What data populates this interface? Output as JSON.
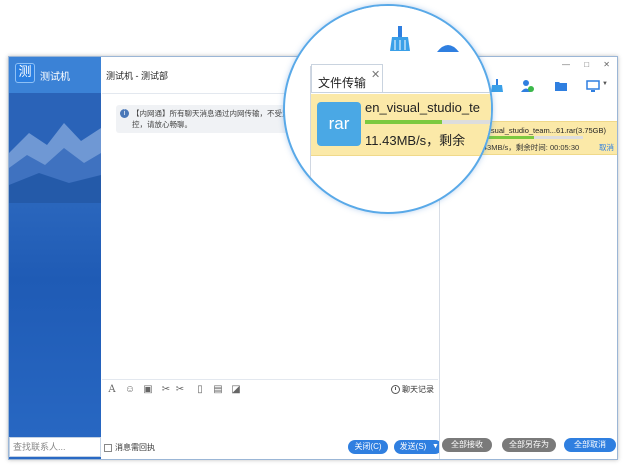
{
  "app": {
    "name": "测试机",
    "logo_char": "测"
  },
  "sidebar": {
    "search_placeholder": "查找联系人..."
  },
  "chat": {
    "title": "测试机 - 测试部",
    "notice": "【内网通】所有聊天消息通过内网传输，不受监控，请放心畅聊。",
    "history_label": "聊天记录",
    "read_receipt_label": "消息需回执",
    "close_label": "关闭(C)",
    "send_label": "发送(S)"
  },
  "window_controls": "— □ ✕",
  "transfer": {
    "panel_title": "文件传输",
    "file_type": "rar",
    "file_name_full": "en_visual_studio_team...61.rar(3.75GB)",
    "file_name_zoom": "en_visual_studio_te",
    "speed_full": "11.43MB/s，剩余时间: 00:05:30",
    "speed_zoom": "11.43MB/s，剩余",
    "cancel_label": "取消",
    "progress": 0.55
  },
  "actions": {
    "accept_all": "全部接收",
    "save_all_as": "全部另存为",
    "cancel_all": "全部取消"
  },
  "colors": {
    "accent": "#2f7fe0",
    "gray_button": "#7a7a7a",
    "transfer_row": "#fbe9a8",
    "progress": "#7cc93f",
    "rar": "#4aa8e5"
  }
}
